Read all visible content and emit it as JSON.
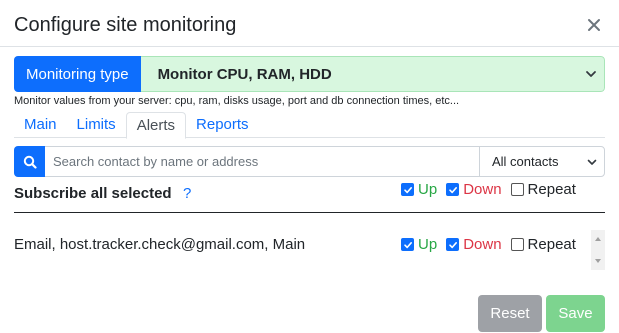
{
  "modal": {
    "title": "Configure site monitoring"
  },
  "monitoring_type": {
    "label": "Monitoring type",
    "selected": "Monitor CPU, RAM, HDD",
    "helper": "Monitor values from your server: cpu, ram, disks usage, port and db connection times, etc..."
  },
  "tabs": [
    {
      "label": "Main",
      "active": false
    },
    {
      "label": "Limits",
      "active": false
    },
    {
      "label": "Alerts",
      "active": true
    },
    {
      "label": "Reports",
      "active": false
    }
  ],
  "search": {
    "placeholder": "Search contact by name or address",
    "filter_selected": "All contacts"
  },
  "subscribe_all": {
    "label": "Subscribe all selected",
    "help": "?",
    "up_label": "Up",
    "up_checked": true,
    "down_label": "Down",
    "down_checked": true,
    "repeat_label": "Repeat",
    "repeat_checked": false
  },
  "contacts": [
    {
      "text": "Email, host.tracker.check@gmail.com, Main",
      "up_label": "Up",
      "up_checked": true,
      "down_label": "Down",
      "down_checked": true,
      "repeat_label": "Repeat",
      "repeat_checked": false
    }
  ],
  "footer": {
    "reset_label": "Reset",
    "save_label": "Save"
  },
  "colors": {
    "primary": "#0d6efd",
    "up": "#28a745",
    "down": "#dc3545",
    "reset_bg": "#9ea1a6",
    "save_bg": "#7dd48f",
    "select_bg": "#d8f7df"
  },
  "icons": {
    "close": "close-icon",
    "search": "search-icon",
    "chevron": "chevron-down-icon",
    "check": "check-icon"
  }
}
